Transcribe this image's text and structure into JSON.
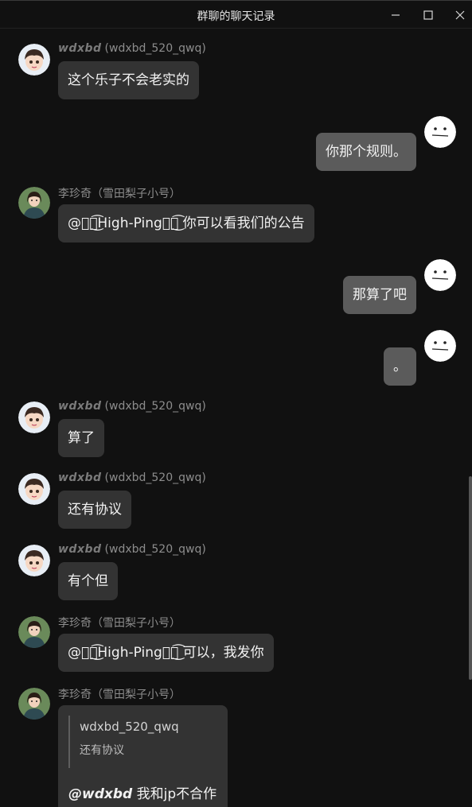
{
  "window": {
    "title": "群聊的聊天记录",
    "controls": {
      "minimize": "minimize-icon",
      "maximize": "maximize-icon",
      "close": "close-icon"
    }
  },
  "messages": [
    {
      "side": "left",
      "avatar": "boy-avatar",
      "nick": "wdxbd",
      "name": "(wdxbd_520_qwq)",
      "text": "这个乐子不会老实的"
    },
    {
      "side": "right",
      "avatar": "neutral-face-avatar",
      "text": "你那个规则。"
    },
    {
      "side": "left",
      "avatar": "girl-avatar",
      "name": "李珍奇（雪田梨子小号）",
      "at": "@ৡৢ͜͡High-Pingৡৢ͜͡",
      "text": " 你可以看我们的公告"
    },
    {
      "side": "right",
      "avatar": "neutral-face-avatar",
      "text": "那算了吧"
    },
    {
      "side": "right",
      "avatar": "neutral-face-avatar",
      "text": "。"
    },
    {
      "side": "left",
      "avatar": "boy-avatar",
      "nick": "wdxbd",
      "name": "(wdxbd_520_qwq)",
      "text": "算了"
    },
    {
      "side": "left",
      "avatar": "boy-avatar",
      "nick": "wdxbd",
      "name": "(wdxbd_520_qwq)",
      "text": "还有协议"
    },
    {
      "side": "left",
      "avatar": "boy-avatar",
      "nick": "wdxbd",
      "name": "(wdxbd_520_qwq)",
      "text": "有个但"
    },
    {
      "side": "left",
      "avatar": "girl-avatar",
      "name": "李珍奇（雪田梨子小号）",
      "at": "@ৡৢ͜͡High-Pingৡৢ͜͡",
      "text": " 可以，我发你"
    },
    {
      "side": "left",
      "avatar": "girl-avatar",
      "name": "李珍奇（雪田梨子小号）",
      "quote": {
        "user": "wdxbd_520_qwq",
        "text": "还有协议"
      },
      "reply_at": "@wdxbd",
      "text": " 我和jp不合作"
    }
  ],
  "colors": {
    "background": "#111111",
    "bubble_other": "#333333",
    "bubble_self": "#5b5b5b"
  }
}
